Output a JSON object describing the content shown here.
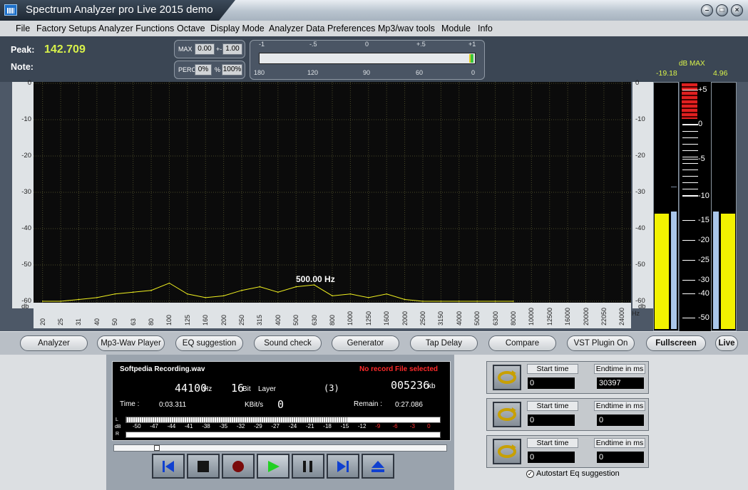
{
  "window": {
    "title": "Spectrum Analyzer pro Live 2015 demo"
  },
  "menu": [
    "File",
    "Factory Setups",
    "Analyzer Functions",
    "Octave",
    "Display Mode",
    "Analyzer Data",
    "Preferences",
    "Mp3/wav tools",
    "Module",
    "Info"
  ],
  "info": {
    "peak_label": "Peak:",
    "peak_value": "142.709",
    "note_label": "Note:",
    "max_label": "MAX",
    "max_val1": "0.00",
    "max_sep": "+-",
    "max_val2": "1.00",
    "perc_label": "PERC",
    "perc_val1": "0%",
    "perc_sep": "%",
    "perc_val2": "100%",
    "meter_top": [
      "-1",
      "-.5",
      "0",
      "+.5",
      "+1"
    ],
    "meter_bottom": [
      "180",
      "120",
      "90",
      "60",
      "0"
    ],
    "db_max_label": "dB MAX",
    "db_left": "-19.18",
    "db_right": "4.96"
  },
  "spectrum": {
    "y_ticks": [
      "0",
      "-10",
      "-20",
      "-30",
      "-40",
      "-50",
      "-60"
    ],
    "y_unit": "db",
    "x_unit": "Hz",
    "x_labels": [
      "20",
      "25",
      "31",
      "40",
      "50",
      "63",
      "80",
      "100",
      "125",
      "160",
      "200",
      "250",
      "315",
      "400",
      "500",
      "630",
      "800",
      "1000",
      "1250",
      "1600",
      "2000",
      "2500",
      "3150",
      "4000",
      "5000",
      "6300",
      "8000",
      "10000",
      "12500",
      "16000",
      "20000",
      "22050",
      "24000"
    ],
    "peak_annotation": "500.00 Hz",
    "chart_data": {
      "type": "line",
      "x": [
        "20",
        "25",
        "31",
        "40",
        "50",
        "63",
        "80",
        "100",
        "125",
        "160",
        "200",
        "250",
        "315",
        "400",
        "500",
        "630",
        "800",
        "1000",
        "1250",
        "1600",
        "2000",
        "2500",
        "3150",
        "4000",
        "5000",
        "6300",
        "8000"
      ],
      "y": [
        -60,
        -60,
        -59.5,
        -59,
        -58,
        -57.5,
        -57,
        -55,
        -58,
        -59,
        -58.5,
        -57,
        -56,
        -57.5,
        -56,
        -55.5,
        -58.5,
        -58,
        -59,
        -58,
        -59.5,
        -60,
        -60,
        -60,
        -60,
        -60,
        -60
      ],
      "ylim": [
        -60,
        0
      ]
    }
  },
  "vu": {
    "ticks": [
      "+5",
      "0",
      "-5",
      "-10",
      "-15",
      "-20",
      "-25",
      "-30",
      "-40",
      "-50"
    ],
    "left_level": 0.52,
    "right_level": 0.52
  },
  "buttons": [
    "Analyzer",
    "Mp3-Wav Player",
    "EQ suggestion",
    "Sound check",
    "Generator",
    "Tap Delay",
    "Compare",
    "VST Plugin On",
    "Fullscreen",
    "Live"
  ],
  "player": {
    "filename": "Softpedia Recording.wav",
    "status": "No record File selected",
    "rate": "44100",
    "rate_unit": "Hz",
    "bits": "16",
    "bits_unit": "Bit",
    "layer_label": "Layer",
    "layer_value": "(3)",
    "kb_value": "005236",
    "kb_unit": "kb",
    "time_label": "Time :",
    "time_value": "0:03.311",
    "kbits_label": "KBit/s",
    "kbits_value": "0",
    "remain_label": "Remain :",
    "remain_value": "0:27.086",
    "level_ticks": [
      "-50",
      "-47",
      "-44",
      "-41",
      "-38",
      "-35",
      "-32",
      "-29",
      "-27",
      "-24",
      "-21",
      "-18",
      "-15",
      "-12",
      "-9",
      "-6",
      "-3",
      "0"
    ],
    "level_l": "L",
    "level_db": "dB",
    "level_r": "R",
    "position": 0.13
  },
  "loops": [
    {
      "start_label": "Start time",
      "end_label": "Endtime in ms",
      "start": "0",
      "end": "30397"
    },
    {
      "start_label": "Start time",
      "end_label": "Endtime in ms",
      "start": "0",
      "end": "0"
    },
    {
      "start_label": "Start time",
      "end_label": "Endtime in ms",
      "start": "0",
      "end": "0"
    }
  ],
  "autostart_label": "Autostart Eq suggestion"
}
